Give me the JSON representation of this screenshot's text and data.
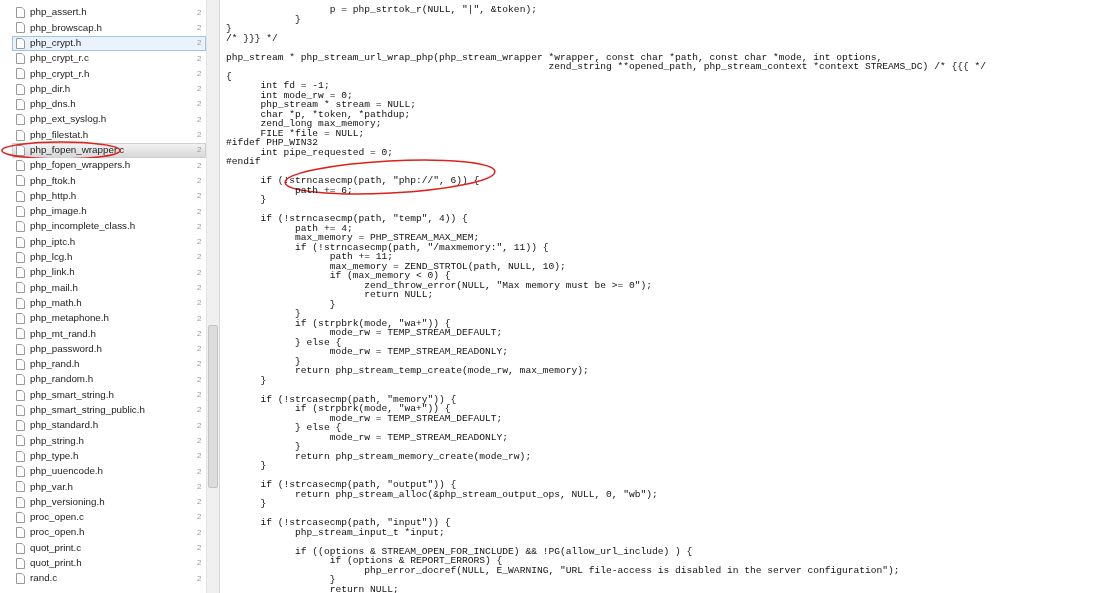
{
  "file_list": {
    "files": [
      {
        "name": "php_assert.h",
        "column_2": "2",
        "hovered": false,
        "selected": false,
        "circled": false
      },
      {
        "name": "php_browscap.h",
        "column_2": "2",
        "hovered": false,
        "selected": false,
        "circled": false
      },
      {
        "name": "php_crypt.h",
        "column_2": "2",
        "hovered": true,
        "selected": false,
        "circled": false
      },
      {
        "name": "php_crypt_r.c",
        "column_2": "2",
        "hovered": false,
        "selected": false,
        "circled": false
      },
      {
        "name": "php_crypt_r.h",
        "column_2": "2",
        "hovered": false,
        "selected": false,
        "circled": false
      },
      {
        "name": "php_dir.h",
        "column_2": "2",
        "hovered": false,
        "selected": false,
        "circled": false
      },
      {
        "name": "php_dns.h",
        "column_2": "2",
        "hovered": false,
        "selected": false,
        "circled": false
      },
      {
        "name": "php_ext_syslog.h",
        "column_2": "2",
        "hovered": false,
        "selected": false,
        "circled": false
      },
      {
        "name": "php_filestat.h",
        "column_2": "2",
        "hovered": false,
        "selected": false,
        "circled": false
      },
      {
        "name": "php_fopen_wrapper.c",
        "column_2": "2",
        "hovered": false,
        "selected": true,
        "circled": true
      },
      {
        "name": "php_fopen_wrappers.h",
        "column_2": "2",
        "hovered": false,
        "selected": false,
        "circled": false
      },
      {
        "name": "php_ftok.h",
        "column_2": "2",
        "hovered": false,
        "selected": false,
        "circled": false
      },
      {
        "name": "php_http.h",
        "column_2": "2",
        "hovered": false,
        "selected": false,
        "circled": false
      },
      {
        "name": "php_image.h",
        "column_2": "2",
        "hovered": false,
        "selected": false,
        "circled": false
      },
      {
        "name": "php_incomplete_class.h",
        "column_2": "2",
        "hovered": false,
        "selected": false,
        "circled": false
      },
      {
        "name": "php_iptc.h",
        "column_2": "2",
        "hovered": false,
        "selected": false,
        "circled": false
      },
      {
        "name": "php_lcg.h",
        "column_2": "2",
        "hovered": false,
        "selected": false,
        "circled": false
      },
      {
        "name": "php_link.h",
        "column_2": "2",
        "hovered": false,
        "selected": false,
        "circled": false
      },
      {
        "name": "php_mail.h",
        "column_2": "2",
        "hovered": false,
        "selected": false,
        "circled": false
      },
      {
        "name": "php_math.h",
        "column_2": "2",
        "hovered": false,
        "selected": false,
        "circled": false
      },
      {
        "name": "php_metaphone.h",
        "column_2": "2",
        "hovered": false,
        "selected": false,
        "circled": false
      },
      {
        "name": "php_mt_rand.h",
        "column_2": "2",
        "hovered": false,
        "selected": false,
        "circled": false
      },
      {
        "name": "php_password.h",
        "column_2": "2",
        "hovered": false,
        "selected": false,
        "circled": false
      },
      {
        "name": "php_rand.h",
        "column_2": "2",
        "hovered": false,
        "selected": false,
        "circled": false
      },
      {
        "name": "php_random.h",
        "column_2": "2",
        "hovered": false,
        "selected": false,
        "circled": false
      },
      {
        "name": "php_smart_string.h",
        "column_2": "2",
        "hovered": false,
        "selected": false,
        "circled": false
      },
      {
        "name": "php_smart_string_public.h",
        "column_2": "2",
        "hovered": false,
        "selected": false,
        "circled": false
      },
      {
        "name": "php_standard.h",
        "column_2": "2",
        "hovered": false,
        "selected": false,
        "circled": false
      },
      {
        "name": "php_string.h",
        "column_2": "2",
        "hovered": false,
        "selected": false,
        "circled": false
      },
      {
        "name": "php_type.h",
        "column_2": "2",
        "hovered": false,
        "selected": false,
        "circled": false
      },
      {
        "name": "php_uuencode.h",
        "column_2": "2",
        "hovered": false,
        "selected": false,
        "circled": false
      },
      {
        "name": "php_var.h",
        "column_2": "2",
        "hovered": false,
        "selected": false,
        "circled": false
      },
      {
        "name": "php_versioning.h",
        "column_2": "2",
        "hovered": false,
        "selected": false,
        "circled": false
      },
      {
        "name": "proc_open.c",
        "column_2": "2",
        "hovered": false,
        "selected": false,
        "circled": false
      },
      {
        "name": "proc_open.h",
        "column_2": "2",
        "hovered": false,
        "selected": false,
        "circled": false
      },
      {
        "name": "quot_print.c",
        "column_2": "2",
        "hovered": false,
        "selected": false,
        "circled": false
      },
      {
        "name": "quot_print.h",
        "column_2": "2",
        "hovered": false,
        "selected": false,
        "circled": false
      },
      {
        "name": "rand.c",
        "column_2": "2",
        "hovered": false,
        "selected": false,
        "circled": false
      }
    ]
  },
  "editor": {
    "blocks": [
      {
        "lines": [
          {
            "text": "\t\t\tp = php_strtok_r(NULL, \"|\", &token);",
            "circled": false
          },
          {
            "text": "\t\t}",
            "circled": false
          },
          {
            "text": "}",
            "circled": false
          },
          {
            "text": "/* }}} */",
            "circled": false
          }
        ]
      },
      {
        "lines": [
          {
            "text": "php_stream * php_stream_url_wrap_php(php_stream_wrapper *wrapper, const char *path, const char *mode, int options,",
            "circled": false
          },
          {
            "text": "\t\t\t\t\t\t\t\t\t  zend_string **opened_path, php_stream_context *context STREAMS_DC) /* {{{ */",
            "circled": false
          },
          {
            "text": "{",
            "circled": false
          },
          {
            "text": "\tint fd = -1;",
            "circled": false
          },
          {
            "text": "\tint mode_rw = 0;",
            "circled": false
          },
          {
            "text": "\tphp_stream * stream = NULL;",
            "circled": false
          },
          {
            "text": "\tchar *p, *token, *pathdup;",
            "circled": false
          },
          {
            "text": "\tzend_long max_memory;",
            "circled": false
          },
          {
            "text": "\tFILE *file = NULL;",
            "circled": false
          },
          {
            "text": "#ifdef PHP_WIN32",
            "circled": false
          },
          {
            "text": "\tint pipe_requested = 0;",
            "circled": false
          },
          {
            "text": "#endif",
            "circled": false
          }
        ]
      },
      {
        "lines": [
          {
            "text": "\tif (!strncasecmp(path, \"php://\", 6)) {",
            "circled": true
          },
          {
            "text": "\t\tpath += 6;",
            "circled": false
          },
          {
            "text": "\t}",
            "circled": false
          }
        ]
      },
      {
        "lines": [
          {
            "text": "\tif (!strncasecmp(path, \"temp\", 4)) {",
            "circled": false
          },
          {
            "text": "\t\tpath += 4;",
            "circled": false
          },
          {
            "text": "\t\tmax_memory = PHP_STREAM_MAX_MEM;",
            "circled": false
          },
          {
            "text": "\t\tif (!strncasecmp(path, \"/maxmemory:\", 11)) {",
            "circled": false
          },
          {
            "text": "\t\t\tpath += 11;",
            "circled": false
          },
          {
            "text": "\t\t\tmax_memory = ZEND_STRTOL(path, NULL, 10);",
            "circled": false
          },
          {
            "text": "\t\t\tif (max_memory < 0) {",
            "circled": false
          },
          {
            "text": "\t\t\t\tzend_throw_error(NULL, \"Max memory must be >= 0\");",
            "circled": false
          },
          {
            "text": "\t\t\t\treturn NULL;",
            "circled": false
          },
          {
            "text": "\t\t\t}",
            "circled": false
          },
          {
            "text": "\t\t}",
            "circled": false
          },
          {
            "text": "\t\tif (strpbrk(mode, \"wa+\")) {",
            "circled": false
          },
          {
            "text": "\t\t\tmode_rw = TEMP_STREAM_DEFAULT;",
            "circled": false
          },
          {
            "text": "\t\t} else {",
            "circled": false
          },
          {
            "text": "\t\t\tmode_rw = TEMP_STREAM_READONLY;",
            "circled": false
          },
          {
            "text": "\t\t}",
            "circled": false
          },
          {
            "text": "\t\treturn php_stream_temp_create(mode_rw, max_memory);",
            "circled": false
          },
          {
            "text": "\t}",
            "circled": false
          }
        ]
      },
      {
        "lines": [
          {
            "text": "\tif (!strcasecmp(path, \"memory\")) {",
            "circled": false
          },
          {
            "text": "\t\tif (strpbrk(mode, \"wa+\")) {",
            "circled": false
          },
          {
            "text": "\t\t\tmode_rw = TEMP_STREAM_DEFAULT;",
            "circled": false
          },
          {
            "text": "\t\t} else {",
            "circled": false
          },
          {
            "text": "\t\t\tmode_rw = TEMP_STREAM_READONLY;",
            "circled": false
          },
          {
            "text": "\t\t}",
            "circled": false
          },
          {
            "text": "\t\treturn php_stream_memory_create(mode_rw);",
            "circled": false
          },
          {
            "text": "\t}",
            "circled": false
          }
        ]
      },
      {
        "lines": [
          {
            "text": "\tif (!strcasecmp(path, \"output\")) {",
            "circled": false
          },
          {
            "text": "\t\treturn php_stream_alloc(&php_stream_output_ops, NULL, 0, \"wb\");",
            "circled": false
          },
          {
            "text": "\t}",
            "circled": false
          }
        ]
      },
      {
        "lines": [
          {
            "text": "\tif (!strcasecmp(path, \"input\")) {",
            "circled": false
          },
          {
            "text": "\t\tphp_stream_input_t *input;",
            "circled": false
          }
        ]
      },
      {
        "lines": [
          {
            "text": "\t\tif ((options & STREAM_OPEN_FOR_INCLUDE) && !PG(allow_url_include) ) {",
            "circled": false
          },
          {
            "text": "\t\t\tif (options & REPORT_ERRORS) {",
            "circled": false
          },
          {
            "text": "\t\t\t\tphp_error_docref(NULL, E_WARNING, \"URL file-access is disabled in the server configuration\");",
            "circled": false
          },
          {
            "text": "\t\t\t}",
            "circled": false
          },
          {
            "text": "\t\t\treturn NULL;",
            "circled": false
          }
        ]
      }
    ]
  }
}
